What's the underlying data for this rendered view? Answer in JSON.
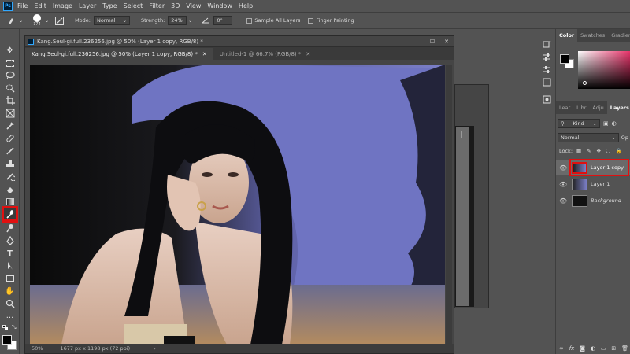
{
  "menu": [
    "File",
    "Edit",
    "Image",
    "Layer",
    "Type",
    "Select",
    "Filter",
    "3D",
    "View",
    "Window",
    "Help"
  ],
  "options": {
    "brush_size": "174",
    "mode_label": "Mode:",
    "mode_value": "Normal",
    "strength_label": "Strength:",
    "strength_value": "24%",
    "angle_value": "0°",
    "sample_all_layers": "Sample All Layers",
    "finger_painting": "Finger Painting"
  },
  "document": {
    "title": "Kang.Seul-gi.full.236256.jpg @ 50% (Layer 1 copy, RGB/8) *",
    "tabs": [
      {
        "label": "Kang.Seul-gi.full.236256.jpg @ 50% (Layer 1 copy, RGB/8) *"
      },
      {
        "label": "Untitled-1 @ 66.7% (RGB/8) *"
      }
    ],
    "zoom": "50%",
    "dimensions": "1677 px x 1198 px (72 ppi)"
  },
  "panels": {
    "top_tabs": [
      "Color",
      "Swatches",
      "Gradients"
    ],
    "layer_tabs": [
      "Lear",
      "Libr",
      "Adju",
      "Layers"
    ],
    "kind_label": "Kind",
    "blend_mode": "Normal",
    "opacity_abbr": "Op",
    "lock_label": "Lock:",
    "layers": [
      {
        "name": "Layer 1 copy",
        "selected": true
      },
      {
        "name": "Layer 1",
        "selected": false
      },
      {
        "name": "Background",
        "selected": false
      }
    ]
  },
  "colors": {
    "accent_highlight": "#e01010",
    "selected_layer": "#6a6a6a"
  }
}
